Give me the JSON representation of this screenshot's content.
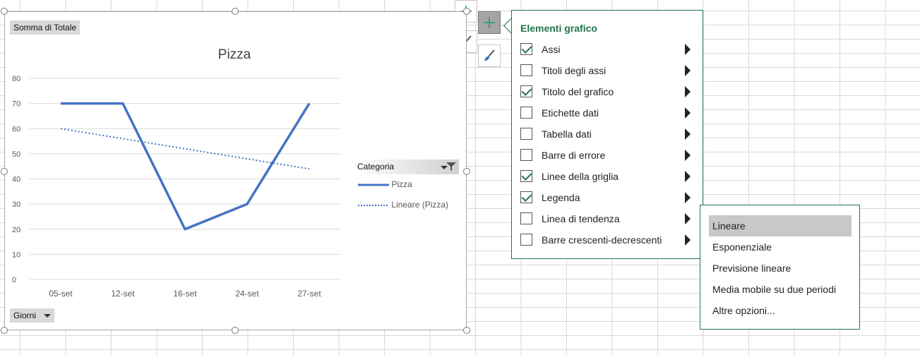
{
  "chart": {
    "pivot_value_button": "Somma di Totale",
    "pivot_axis_button": "Giorni",
    "legend_title": "Categoria"
  },
  "chart_data": {
    "type": "line",
    "title": "Pizza",
    "categories": [
      "05-set",
      "12-set",
      "16-set",
      "24-set",
      "27-set"
    ],
    "series": [
      {
        "name": "Pizza",
        "values": [
          70,
          70,
          20,
          30,
          70
        ],
        "style": "solid",
        "color": "#4472C4"
      },
      {
        "name": "Lineare (Pizza)",
        "values": [
          60,
          56,
          52,
          48,
          44
        ],
        "style": "dotted",
        "color": "#4472C4"
      }
    ],
    "ylim": [
      0,
      80
    ],
    "yticks": [
      0,
      10,
      20,
      30,
      40,
      50,
      60,
      70,
      80
    ],
    "grid": true,
    "legend_position": "right"
  },
  "side_buttons": [
    {
      "icon": "plus-icon"
    },
    {
      "icon": "brush-icon"
    }
  ],
  "panel": {
    "title": "Elementi grafico",
    "items": [
      {
        "label": "Assi",
        "checked": true
      },
      {
        "label": "Titoli degli assi",
        "checked": false
      },
      {
        "label": "Titolo del grafico",
        "checked": true
      },
      {
        "label": "Etichette dati",
        "checked": false
      },
      {
        "label": "Tabella dati",
        "checked": false
      },
      {
        "label": "Barre di errore",
        "checked": false
      },
      {
        "label": "Linee della griglia",
        "checked": true
      },
      {
        "label": "Legenda",
        "checked": true
      },
      {
        "label": "Linea di tendenza",
        "checked": false
      },
      {
        "label": "Barre crescenti-decrescenti",
        "checked": false
      }
    ]
  },
  "submenu": {
    "items": [
      {
        "label": "Lineare",
        "selected": true
      },
      {
        "label": "Esponenziale",
        "selected": false
      },
      {
        "label": "Previsione lineare",
        "selected": false
      },
      {
        "label": "Media mobile su due periodi",
        "selected": false
      },
      {
        "label": "Altre opzioni...",
        "selected": false
      }
    ]
  },
  "colors": {
    "accent": "#217346",
    "series": "#4472C4"
  }
}
